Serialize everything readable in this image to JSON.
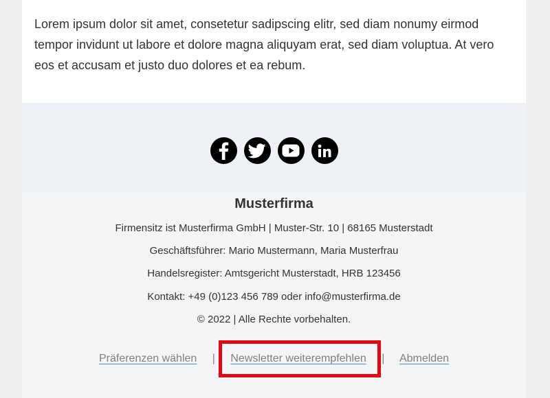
{
  "content": {
    "paragraph": "Lorem ipsum dolor sit amet, consetetur sadipscing elitr, sed diam nonumy eirmod tempor invidunt ut labore et dolore magna aliquyam erat, sed diam voluptua. At vero eos et accusam et justo duo dolores et ea rebum."
  },
  "social": {
    "icons": [
      "facebook-icon",
      "twitter-icon",
      "youtube-icon",
      "linkedin-icon"
    ],
    "icon_color": "#000000"
  },
  "footer": {
    "company_name": "Musterfirma",
    "lines": [
      "Firmensitz ist Musterfirma GmbH | Muster-Str. 10 | 68165 Musterstadt",
      "Geschäftsführer: Mario Mustermann, Maria Musterfrau",
      "Handelsregister: Amtsgericht Musterstadt, HRB 123456",
      "Kontakt: +49 (0)123 456 789 oder info@musterfirma.de",
      "© 2022 | Alle Rechte vorbehalten."
    ],
    "links": {
      "preferences": "Präferenzen wählen",
      "separator": "|",
      "recommend": "Newsletter weiterempfehlen",
      "unsubscribe": "Abmelden"
    }
  },
  "colors": {
    "highlight": "#e30613",
    "link_underline": "#3d8fe0"
  }
}
